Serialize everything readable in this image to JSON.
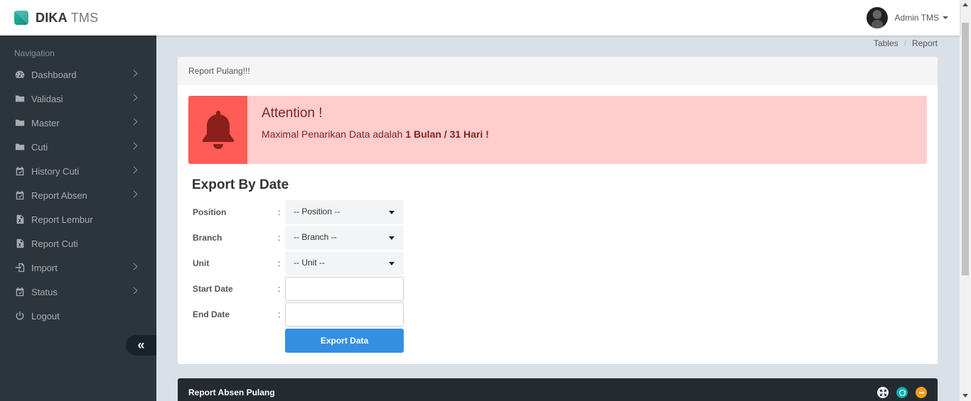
{
  "header": {
    "brand_bold": "DIKA",
    "brand_light": "TMS",
    "user_name": "Admin TMS"
  },
  "sidebar": {
    "nav_header": "Navigation",
    "items": [
      {
        "label": "Dashboard",
        "icon": "dashboard-icon",
        "has_caret": true
      },
      {
        "label": "Validasi",
        "icon": "folder-icon",
        "has_caret": true
      },
      {
        "label": "Master",
        "icon": "folder-icon",
        "has_caret": true
      },
      {
        "label": "Cuti",
        "icon": "folder-icon",
        "has_caret": true
      },
      {
        "label": "History Cuti",
        "icon": "calendar-check-icon",
        "has_caret": true
      },
      {
        "label": "Report Absen",
        "icon": "calendar-check-icon",
        "has_caret": true
      },
      {
        "label": "Report Lembur",
        "icon": "excel-file-icon",
        "has_caret": false
      },
      {
        "label": "Report Cuti",
        "icon": "excel-file-icon",
        "has_caret": false
      },
      {
        "label": "Import",
        "icon": "import-icon",
        "has_caret": true
      },
      {
        "label": "Status",
        "icon": "calendar-check-icon",
        "has_caret": true
      },
      {
        "label": "Logout",
        "icon": "power-icon",
        "has_caret": false
      }
    ],
    "minify_glyph": "«"
  },
  "breadcrumb": {
    "items": [
      "Tables",
      "Report"
    ],
    "separator": "/"
  },
  "panel": {
    "heading": "Report Pulang!!!"
  },
  "alert": {
    "title": "Attention !",
    "text": "Maximal Penarikan Data adalah",
    "text_bold": "1 Bulan / 31 Hari !"
  },
  "form": {
    "title": "Export By Date",
    "colon": ":",
    "position_label": "Position",
    "position_value": "-- Position --",
    "branch_label": "Branch",
    "branch_value": "-- Branch --",
    "unit_label": "Unit",
    "unit_value": "-- Unit --",
    "start_label": "Start Date",
    "start_value": "",
    "end_label": "End Date",
    "end_value": "",
    "export_label": "Export Data"
  },
  "panel2": {
    "title": "Report Absen Pulang"
  },
  "colors": {
    "sidebar_bg": "#2d353c",
    "alert_bg": "#ffcdcc",
    "alert_icon_bg": "#ff5b57",
    "primary_button": "#348fe2",
    "reload_button": "#00acac",
    "collapse_button": "#f59c1a"
  }
}
